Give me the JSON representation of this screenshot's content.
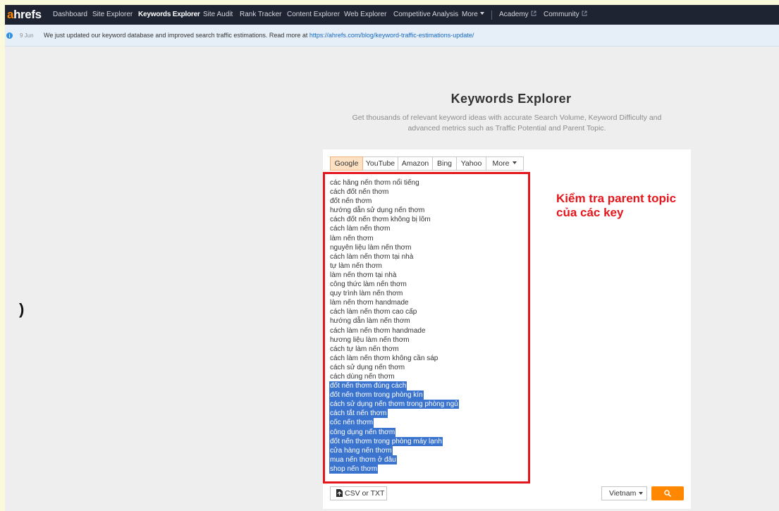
{
  "nav": {
    "logo_accent": "a",
    "logo_rest": "hrefs",
    "items": [
      {
        "label": "Dashboard",
        "active": false
      },
      {
        "label": "Site Explorer",
        "active": false
      },
      {
        "label": "Keywords Explorer",
        "active": true
      },
      {
        "label": "Site Audit",
        "active": false
      },
      {
        "label": "Rank Tracker",
        "active": false
      },
      {
        "label": "Content Explorer",
        "active": false
      },
      {
        "label": "Web Explorer",
        "active": false
      },
      {
        "label": "Competitive Analysis",
        "active": false
      }
    ],
    "more_label": "More",
    "academy_label": "Academy",
    "community_label": "Community"
  },
  "notice": {
    "date": "9 Jun",
    "message": "We just updated our keyword database and improved search traffic estimations. Read more at",
    "link_text": "https://ahrefs.com/blog/keyword-traffic-estimations-update/"
  },
  "stray_glyph": ")",
  "hero": {
    "title": "Keywords Explorer",
    "subtitle_line1": "Get thousands of relevant keyword ideas with accurate Search Volume, Keyword Difficulty and",
    "subtitle_line2": "advanced metrics such as Traffic Potential and Parent Topic."
  },
  "engines": [
    {
      "label": "Google",
      "active": true
    },
    {
      "label": "YouTube",
      "active": false
    },
    {
      "label": "Amazon",
      "active": false
    },
    {
      "label": "Bing",
      "active": false
    },
    {
      "label": "Yahoo",
      "active": false
    },
    {
      "label": "More",
      "active": false
    }
  ],
  "keywords": [
    {
      "text": "các hãng nến thơm nổi tiếng",
      "selected": false
    },
    {
      "text": "cách đốt nến thơm",
      "selected": false
    },
    {
      "text": "đốt nến thơm",
      "selected": false
    },
    {
      "text": "hướng dẫn sử dụng nến thơm",
      "selected": false
    },
    {
      "text": "cách đốt nến thơm không bị lõm",
      "selected": false
    },
    {
      "text": "cách làm nến thơm",
      "selected": false
    },
    {
      "text": "làm nến thơm",
      "selected": false
    },
    {
      "text": "nguyên liệu làm nến thơm",
      "selected": false
    },
    {
      "text": "cách làm nến thơm tại nhà",
      "selected": false
    },
    {
      "text": "tự làm nến thơm",
      "selected": false
    },
    {
      "text": "làm nến thơm tại nhà",
      "selected": false
    },
    {
      "text": "công thức làm nến thơm",
      "selected": false
    },
    {
      "text": "quy trình làm nến thơm",
      "selected": false
    },
    {
      "text": "làm nến thơm handmade",
      "selected": false
    },
    {
      "text": "cách làm nến thơm cao cấp",
      "selected": false
    },
    {
      "text": "hướng dẫn làm nến thơm",
      "selected": false
    },
    {
      "text": "cách làm nến thơm handmade",
      "selected": false
    },
    {
      "text": "hương liệu làm nến thơm",
      "selected": false
    },
    {
      "text": "cách tự làm nến thơm",
      "selected": false
    },
    {
      "text": "cách làm nến thơm không cần sáp",
      "selected": false
    },
    {
      "text": "cách sử dụng nến thơm",
      "selected": false
    },
    {
      "text": "cách dùng nến thơm",
      "selected": false
    },
    {
      "text": "đốt nến thơm đúng cách",
      "selected": true
    },
    {
      "text": "đốt nến thơm trong phòng kín",
      "selected": true
    },
    {
      "text": "cách sử dụng nến thơm trong phòng ngủ",
      "selected": true
    },
    {
      "text": "cách tắt nến thơm",
      "selected": true
    },
    {
      "text": "cốc nến thơm",
      "selected": true
    },
    {
      "text": "công dụng nến thơm",
      "selected": true
    },
    {
      "text": "đốt nến thơm trong phòng máy lạnh",
      "selected": true
    },
    {
      "text": "cửa hàng nến thơm",
      "selected": true
    },
    {
      "text": "mua nến thơm ở đâu",
      "selected": true
    },
    {
      "text": "shop nến thơm",
      "selected": true
    }
  ],
  "annotation": {
    "line1": "Kiểm tra parent topic",
    "line2": "của các key"
  },
  "footer": {
    "csv_label": "CSV or TXT",
    "country": "Vietnam"
  },
  "icons": {
    "info": "info-icon",
    "chevron": "chevron-down-icon",
    "external_link": "external-link-icon",
    "file": "file-icon",
    "search": "search-icon"
  },
  "colors": {
    "frame_bg": "#fbf9dc",
    "nav_bg": "#1e2432",
    "nav_text": "#d3d7df",
    "accent_orange": "#ff8800",
    "notice_bg": "#e6eff8",
    "link_blue": "#1668c1",
    "page_bg": "#eeeeee",
    "tab_active_bg": "#fde1c2",
    "annotation_red": "#e5151c",
    "selection_blue": "#3b74cf"
  }
}
